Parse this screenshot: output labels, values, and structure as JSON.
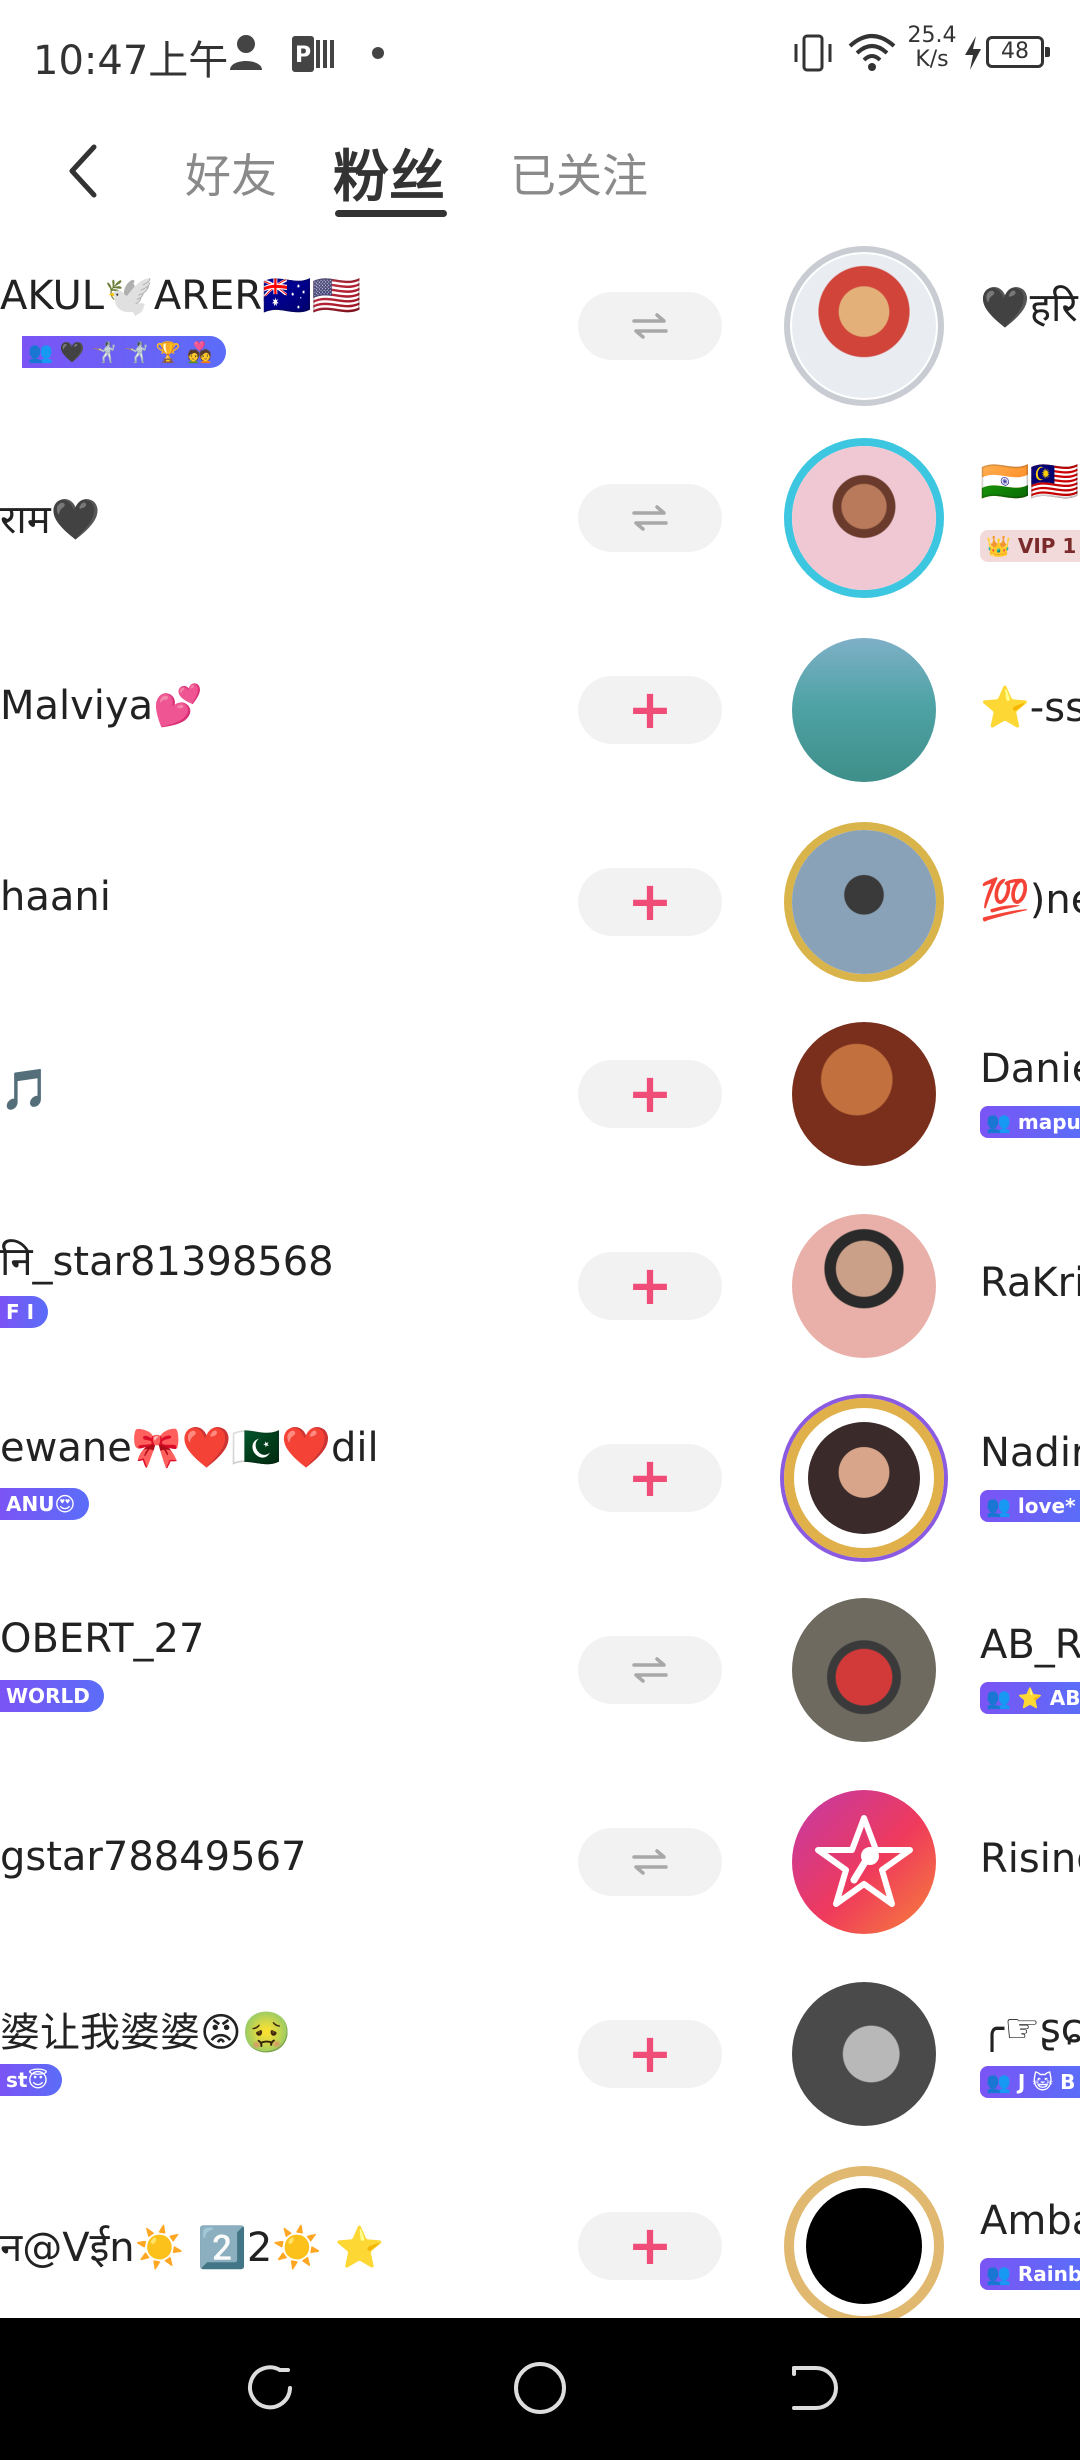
{
  "status_bar": {
    "time": "10:47上午",
    "net_speed_value": "25.4",
    "net_speed_unit": "K/s",
    "battery": "48",
    "icons": [
      "person-icon",
      "p-app-icon",
      "notification-dot-icon",
      "vibrate-icon",
      "wifi-icon",
      "charging-bolt-icon",
      "battery-icon"
    ]
  },
  "header": {
    "tabs": [
      {
        "label": "好友",
        "active": false
      },
      {
        "label": "粉丝",
        "active": true
      },
      {
        "label": "已关注",
        "active": false
      }
    ]
  },
  "colors": {
    "accent_pink": "#f04c78",
    "badge_purple": "#6a5ef6",
    "button_bg": "#f2f2f2"
  },
  "rows": [
    {
      "left_name": "AKUL🕊️ARER🇦🇺🇺🇸",
      "left_badge": "👥 🖤 🤺 🤺 🏆 💑",
      "action": "mutual",
      "right_name": "🖤हरि",
      "right_badge": ""
    },
    {
      "left_name": "राम🖤",
      "left_badge": "",
      "action": "mutual",
      "right_name": "🇮🇳🇲🇾",
      "right_badge": "👑 VIP 1"
    },
    {
      "left_name": "Malviya💕",
      "left_badge": "",
      "action": "follow",
      "right_name": "⭐-ss",
      "right_badge": ""
    },
    {
      "left_name": "haani",
      "left_badge": "",
      "action": "follow",
      "right_name": "💯)ne",
      "right_badge": ""
    },
    {
      "left_name": "🎵",
      "left_badge": "",
      "action": "follow",
      "right_name": "Danie",
      "right_badge": "👥 mapu"
    },
    {
      "left_name": "नि_star81398568",
      "left_badge": "F I",
      "action": "follow",
      "right_name": "RaKri",
      "right_badge": ""
    },
    {
      "left_name": "ewane🎀❤️🇵🇰❤️dil",
      "left_badge": "ANU😍",
      "action": "follow",
      "right_name": "Nadir",
      "right_badge": "👥 love*"
    },
    {
      "left_name": "OBERT_27",
      "left_badge": "WORLD",
      "action": "mutual",
      "right_name": "AB_R",
      "right_badge": "👥 ⭐ AB"
    },
    {
      "left_name": "gstar78849567",
      "left_badge": "",
      "action": "mutual",
      "right_name": "Rising",
      "right_badge": ""
    },
    {
      "left_name": "婆让我婆婆😡🤢",
      "left_badge": "st😇",
      "action": "follow",
      "right_name": "╭☞ʂɕ",
      "right_badge": "👥 J 😺 B"
    },
    {
      "left_name": "न@Vईn☀️ 2️⃣2☀️ ⭐",
      "left_badge": "",
      "action": "follow",
      "right_name": "Amba",
      "right_badge": "👥 Rainb"
    }
  ],
  "nav_bar": {
    "buttons": [
      "recent-apps-icon",
      "home-icon",
      "back-nav-icon"
    ]
  }
}
